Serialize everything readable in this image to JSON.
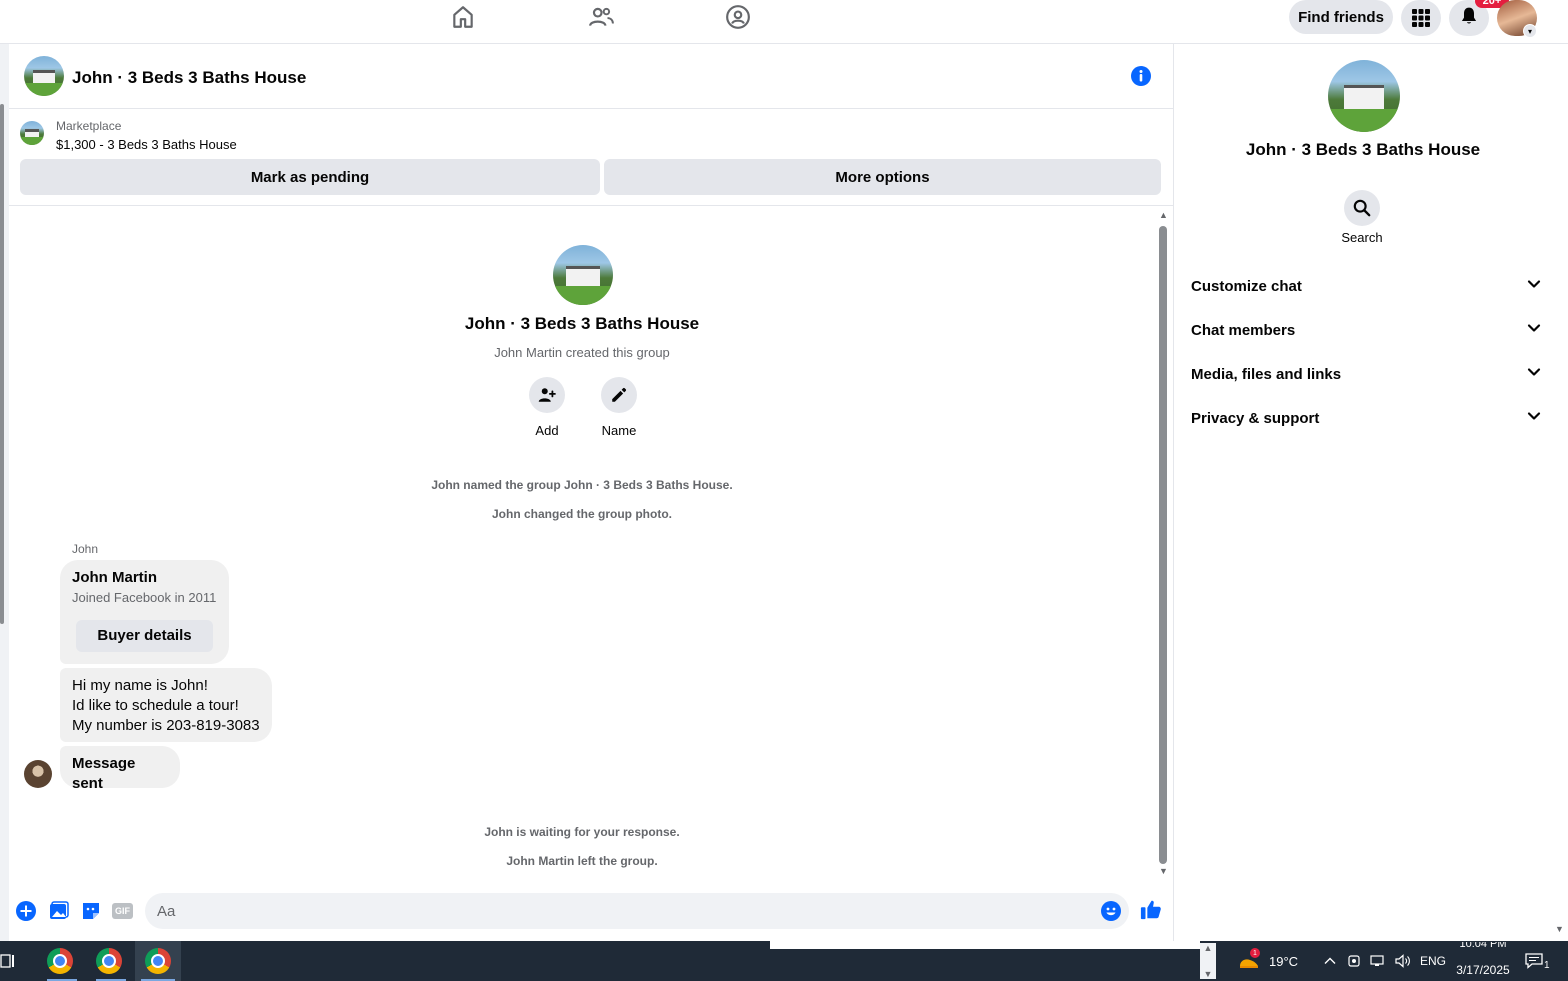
{
  "topnav": {
    "find_friends": "Find friends",
    "notification_badge": "20+",
    "icons": [
      "home-icon",
      "friends-icon",
      "groups-icon",
      "menu-grid-icon",
      "bell-icon"
    ]
  },
  "header": {
    "title": "John · 3 Beds 3 Baths House"
  },
  "marketplace": {
    "label": "Marketplace",
    "listing": "$1,300 - 3 Beds 3 Baths House",
    "mark_pending": "Mark as pending",
    "more_options": "More options"
  },
  "chat": {
    "group_title": "John · 3 Beds 3 Baths House",
    "created_by": "John Martin created this group",
    "add_label": "Add",
    "name_label": "Name",
    "system_messages": [
      "John named the group John · 3 Beds 3 Baths House.",
      "John changed the group photo."
    ],
    "sender_name": "John",
    "profile_card": {
      "name": "John Martin",
      "joined": "Joined Facebook in 2011",
      "button": "Buyer details"
    },
    "message_lines": [
      "Hi my name is John!",
      "Id like to schedule a tour!",
      "My number is 203-819-3083"
    ],
    "message_sent": "Message sent",
    "footer_messages": [
      "John is waiting for your response.",
      "John Martin left the group."
    ]
  },
  "composer": {
    "placeholder": "Aa",
    "gif_label": "GIF"
  },
  "right_panel": {
    "title": "John · 3 Beds 3 Baths House",
    "search_label": "Search",
    "sections": [
      "Customize chat",
      "Chat members",
      "Media, files and links",
      "Privacy & support"
    ]
  },
  "taskbar": {
    "temperature": "19°C",
    "language": "ENG",
    "time": "10:04 PM",
    "date": "3/17/2025",
    "notif_count": "1",
    "weather_badge": "1"
  },
  "colors": {
    "accent": "#0866ff",
    "bubble": "#f0f0f0",
    "button_gray": "#e4e6eb",
    "badge_red": "#e41e3f",
    "taskbar": "#1f2a37"
  }
}
